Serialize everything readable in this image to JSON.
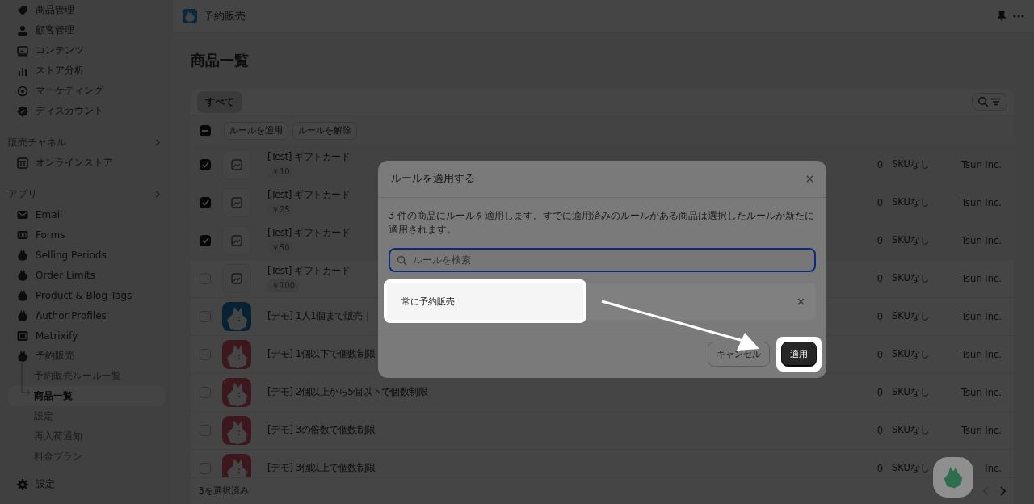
{
  "sidebar": {
    "main_items": [
      "商品管理",
      "顧客管理",
      "コンテンツ",
      "ストア分析",
      "マーケティング",
      "ディスカウント"
    ],
    "sections": [
      {
        "title": "販売チャネル",
        "items": [
          {
            "label": "オンラインストア"
          }
        ]
      },
      {
        "title": "アプリ",
        "items": [
          {
            "label": "Email"
          },
          {
            "label": "Forms"
          },
          {
            "label": "Selling Periods"
          },
          {
            "label": "Order Limits"
          },
          {
            "label": "Product & Blog Tags"
          },
          {
            "label": "Author Profiles"
          },
          {
            "label": "Matrixify"
          },
          {
            "label": "予約販売",
            "children": [
              {
                "label": "予約販売ルール一覧",
                "selected": false
              },
              {
                "label": "商品一覧",
                "selected": true
              },
              {
                "label": "設定",
                "selected": false
              },
              {
                "label": "再入荷通知",
                "selected": false
              },
              {
                "label": "料金プラン",
                "selected": false
              }
            ]
          }
        ]
      }
    ],
    "footer_item": "設定"
  },
  "topbar": {
    "app_title": "予約販売"
  },
  "page_title": "商品一覧",
  "table": {
    "tabs": [
      {
        "label": "すべて",
        "selected": true
      }
    ],
    "select_all_indeterminate": true,
    "bulk_actions": [
      "ルールを適用",
      "ルールを解除"
    ],
    "rows": [
      {
        "name": "[Test] ギフトカード",
        "price": "￥10",
        "checked": true,
        "kind": "placeholder",
        "cells": [
          "0",
          "SKUなし",
          "Tsun Inc."
        ]
      },
      {
        "name": "[Test] ギフトカード",
        "price": "￥25",
        "checked": true,
        "kind": "placeholder",
        "cells": [
          "0",
          "SKUなし",
          "Tsun Inc."
        ]
      },
      {
        "name": "[Test] ギフトカード",
        "price": "￥50",
        "checked": true,
        "kind": "placeholder",
        "cells": [
          "0",
          "SKUなし",
          "Tsun Inc."
        ]
      },
      {
        "name": "[Test] ギフトカード",
        "price": "￥100",
        "checked": false,
        "kind": "placeholder",
        "cells": [
          "0",
          "SKUなし",
          "Tsun Inc."
        ]
      },
      {
        "name": "[デモ] 1人1個まで販売｜",
        "checked": false,
        "kind": "picture",
        "cells": [
          "0",
          "SKUなし",
          "Tsun Inc."
        ]
      },
      {
        "name": "[デモ] 1個以下で個数制限",
        "checked": false,
        "kind": "picture",
        "cells": [
          "0",
          "SKUなし",
          "Tsun Inc."
        ]
      },
      {
        "name": "[デモ] 2個以上から5個以下で個数制限",
        "checked": false,
        "kind": "picture",
        "cells": [
          "0",
          "SKUなし",
          "Tsun Inc."
        ]
      },
      {
        "name": "[デモ] 3の倍数で個数制限",
        "checked": false,
        "kind": "picture",
        "cells": [
          "0",
          "SKUなし",
          "Tsun Inc."
        ]
      },
      {
        "name": "[デモ] 3個以上で個数制限",
        "checked": false,
        "kind": "picture",
        "cells": [
          "0",
          "SKUなし",
          "Inc."
        ]
      }
    ],
    "footer": "3を選択済み"
  },
  "modal": {
    "title": "ルールを適用する",
    "message": "3 件の商品にルールを適用します。すでに適用済みのルールがある商品は選択したルールが新たに適用されます。",
    "search": {
      "placeholder": "ルールを検索"
    },
    "rules": [
      {
        "label": "常に予約販売"
      }
    ],
    "buttons": [
      {
        "label": "キャンセル",
        "kind": "secondary"
      },
      {
        "label": "適用",
        "kind": "primary"
      }
    ]
  }
}
